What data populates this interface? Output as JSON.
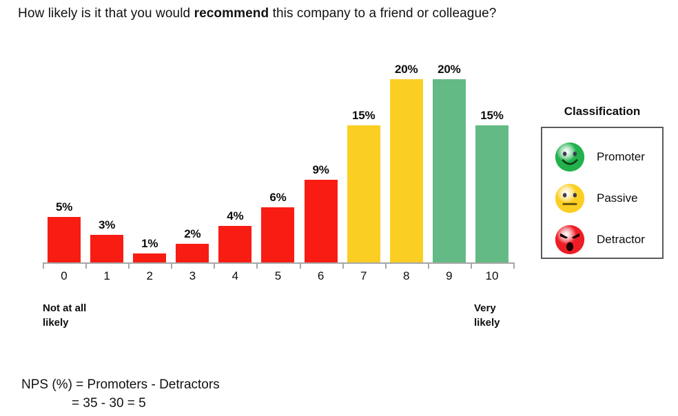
{
  "title": {
    "part1": "How likely is it that you would ",
    "emphasis": "recommend",
    "part2": " this company to a friend or colleague?"
  },
  "chart_data": {
    "type": "bar",
    "title": "How likely is it that you would recommend this company to a friend or colleague?",
    "xlabel": "",
    "ylabel": "",
    "ylim": [
      0,
      20
    ],
    "grid": false,
    "categories": [
      "0",
      "1",
      "2",
      "3",
      "4",
      "5",
      "6",
      "7",
      "8",
      "9",
      "10"
    ],
    "values": [
      5,
      3,
      1,
      2,
      4,
      6,
      9,
      15,
      20,
      20,
      15
    ],
    "value_labels": [
      "5%",
      "3%",
      "1%",
      "2%",
      "4%",
      "6%",
      "9%",
      "15%",
      "20%",
      "20%",
      "15%"
    ],
    "bar_colors": [
      "#f91c13",
      "#f91c13",
      "#f91c13",
      "#f91c13",
      "#f91c13",
      "#f91c13",
      "#f91c13",
      "#fbce23",
      "#fbce23",
      "#64ba85",
      "#64ba85"
    ],
    "classifications": [
      "Detractor",
      "Detractor",
      "Detractor",
      "Detractor",
      "Detractor",
      "Detractor",
      "Detractor",
      "Passive",
      "Passive",
      "Promoter",
      "Promoter"
    ],
    "axis_anchor_low": "Not at all likely",
    "axis_anchor_high": "Very likely",
    "legend_position": "right"
  },
  "axis": {
    "anchor_low_line1": "Not at all",
    "anchor_low_line2": "likely",
    "anchor_high_line1": "Very",
    "anchor_high_line2": "likely"
  },
  "legend": {
    "heading": "Classification",
    "items": [
      {
        "label": "Promoter",
        "color": "#22b14c",
        "face": "smile-face-icon"
      },
      {
        "label": "Passive",
        "color": "#fbce23",
        "face": "neutral-face-icon"
      },
      {
        "label": "Detractor",
        "color": "#ee1c25",
        "face": "angry-face-icon"
      }
    ]
  },
  "formula": {
    "line1": "NPS (%) = Promoters - Detractors",
    "line2": "= 35 - 30 = 5"
  },
  "colors": {
    "detractor": "#f91c13",
    "passive": "#fbce23",
    "promoter": "#64ba85",
    "axis": "#a6a6a6",
    "legend_border": "#595959"
  }
}
